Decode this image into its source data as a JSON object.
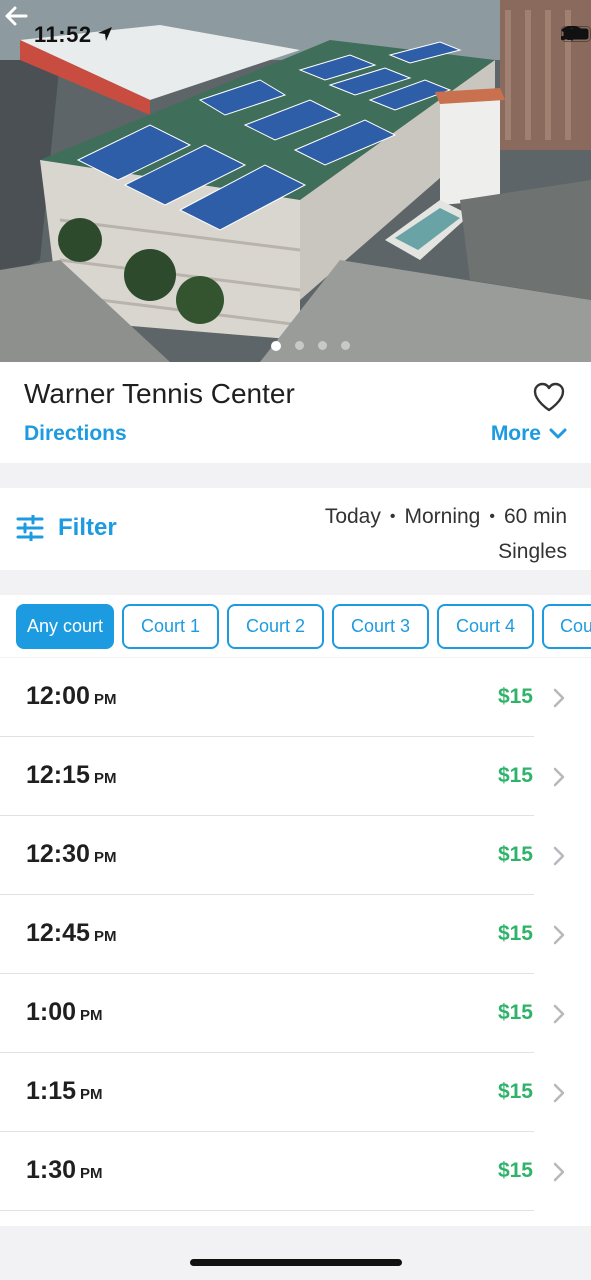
{
  "status_bar": {
    "time": "11:52"
  },
  "hero": {
    "image_alt": "Aerial view of rooftop tennis courts",
    "slide_count": 4,
    "active_slide": 1
  },
  "venue": {
    "name": "Warner Tennis Center",
    "directions_label": "Directions",
    "more_label": "More"
  },
  "filter": {
    "label": "Filter",
    "day": "Today",
    "period": "Morning",
    "duration": "60 min",
    "separator": "•",
    "format": "Singles"
  },
  "courts": [
    {
      "label": "Any court",
      "active": true
    },
    {
      "label": "Court 1",
      "active": false
    },
    {
      "label": "Court 2",
      "active": false
    },
    {
      "label": "Court 3",
      "active": false
    },
    {
      "label": "Court 4",
      "active": false
    },
    {
      "label": "Cou",
      "active": false
    }
  ],
  "slots": [
    {
      "time": "12:00",
      "ampm": "PM",
      "price": "$15"
    },
    {
      "time": "12:15",
      "ampm": "PM",
      "price": "$15"
    },
    {
      "time": "12:30",
      "ampm": "PM",
      "price": "$15"
    },
    {
      "time": "12:45",
      "ampm": "PM",
      "price": "$15"
    },
    {
      "time": "1:00",
      "ampm": "PM",
      "price": "$15"
    },
    {
      "time": "1:15",
      "ampm": "PM",
      "price": "$15"
    },
    {
      "time": "1:30",
      "ampm": "PM",
      "price": "$15"
    }
  ],
  "colors": {
    "accent": "#1d9be0",
    "price": "#2fb36a",
    "background": "#f2f2f4"
  }
}
